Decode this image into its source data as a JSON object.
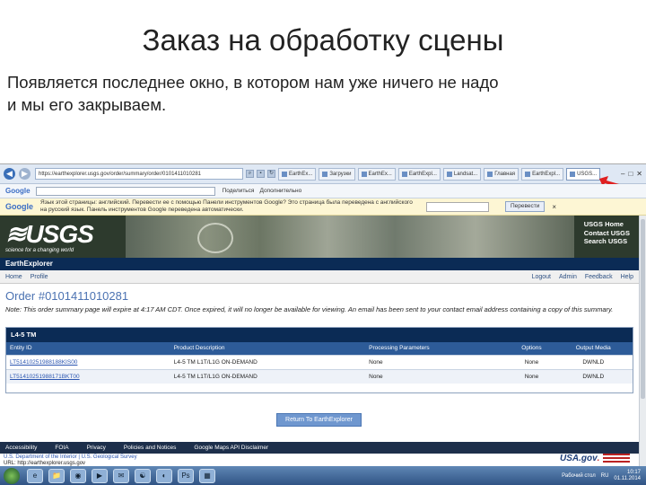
{
  "slide": {
    "title": "Заказ на обработку сцены",
    "text_line1": "Появляется последнее окно, в котором нам уже ничего не надо",
    "text_line2": "и мы его закрываем."
  },
  "browser": {
    "address": "https://earthexplorer.usgs.gov/order/summary/order/0101411010281",
    "tabs": [
      "EarthEx...",
      "Загрузки",
      "EarthEx...",
      "EarthExpl...",
      "Landsat...",
      "Главная",
      "EarthExpl..."
    ],
    "active_tab": "USGS...",
    "window_controls": [
      "–",
      "□",
      "✕"
    ]
  },
  "google_bar": {
    "logo": "Google",
    "tools": [
      "Поделиться",
      "Дополнительно"
    ]
  },
  "translate_bar": {
    "logo": "Google",
    "message": "Язык этой страницы: английский. Перевести ее с помощью Панели инструментов Google? Это страница была переведена с английского на русский язык. Панель инструментов Google переведена автоматически.",
    "button": "Перевести",
    "close": "×"
  },
  "usgs": {
    "logo": "≋USGS",
    "tagline": "science for a changing world",
    "links": [
      "USGS Home",
      "Contact USGS",
      "Search USGS"
    ],
    "app_name": "EarthExplorer"
  },
  "menu": {
    "left": [
      "Home",
      "Profile"
    ],
    "right": [
      "Logout",
      "Admin",
      "Feedback",
      "Help"
    ]
  },
  "order": {
    "title": "Order #0101411010281",
    "note": "Note: This order summary page will expire at 4:17 AM CDT. Once expired, it will no longer be available for viewing. An email has been sent to your contact email address containing a copy of this summary."
  },
  "table": {
    "section_title": "L4-5 TM",
    "headers": [
      "Entity ID",
      "Product Description",
      "Processing Parameters",
      "Options",
      "Output Media"
    ],
    "rows": [
      [
        "LT51410251988188KIS00",
        "L4-5 TM L1T/L1G ON-DEMAND",
        "None",
        "None",
        "DWNLD"
      ],
      [
        "LT51410251988171BKT00",
        "L4-5 TM L1T/L1G ON-DEMAND",
        "None",
        "None",
        "DWNLD"
      ]
    ]
  },
  "return_button": "Return To EarthExplorer",
  "footer": {
    "links": [
      "Accessibility",
      "FOIA",
      "Privacy",
      "Policies and Notices",
      "Google Maps API Disclaimer"
    ],
    "line1": "U.S. Department of the Interior | U.S. Geological Survey",
    "line2": "URL: http://earthexplorer.usgs.gov",
    "usa_logo": "USA.gov",
    "usa_suffix": "."
  },
  "taskbar": {
    "icons": [
      "e",
      "📁",
      "◉",
      "▶",
      "✉",
      "☯",
      "◐",
      "Ps",
      "▦"
    ],
    "tray_text": "Рабочий стол",
    "lang": "RU",
    "time": "10:17",
    "date": "01.11.2014"
  },
  "colors": {
    "ee_bar": "#0b2b55",
    "table_header": "#2d5b98",
    "order_title": "#4b72b2",
    "arrow": "#e02020"
  }
}
